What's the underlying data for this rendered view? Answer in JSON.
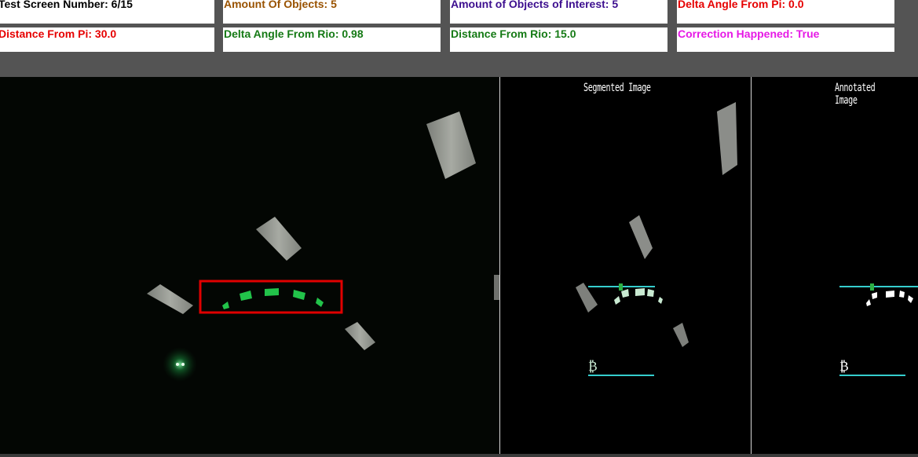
{
  "hud": {
    "test_screen": {
      "text": "Test Screen Number: 6/15",
      "color": "#000000"
    },
    "amount_objects": {
      "text": "Amount Of Objects: 5",
      "color": "#995200"
    },
    "amount_objects_interest": {
      "text": "Amount of Objects of Interest: 5",
      "color": "#3d0f8f"
    },
    "delta_angle_pi": {
      "text": "Delta Angle From Pi: 0.0",
      "color": "#e60000"
    },
    "distance_pi": {
      "text": "Distance From Pi: 30.0",
      "color": "#e60000"
    },
    "delta_angle_rio": {
      "text": "Delta Angle From Rio: 0.98",
      "color": "#157a15"
    },
    "distance_rio": {
      "text": "Distance From Rio: 15.0",
      "color": "#157a15"
    },
    "correction": {
      "text": "Correction Happened: True",
      "color": "#e619e6"
    }
  },
  "views": {
    "segmented_title": "Segmented Image",
    "annotated_title": "Annotated Image"
  },
  "colors": {
    "target_highlight": "#e00000",
    "target_green": "#22c34a",
    "guide_line": "#35cdcd",
    "background": "#545454"
  }
}
